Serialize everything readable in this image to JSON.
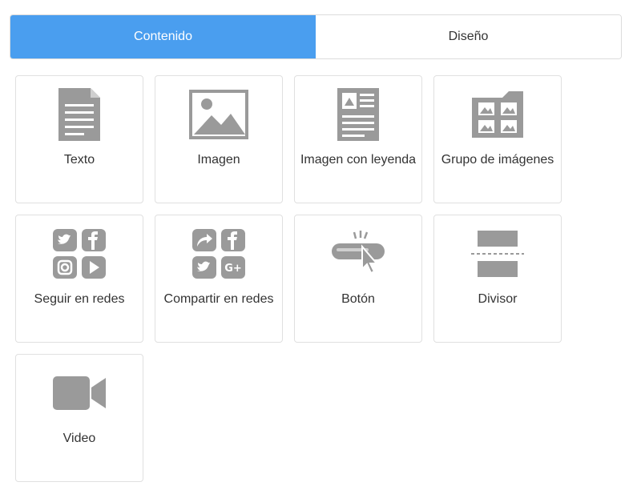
{
  "tabs": [
    {
      "label": "Contenido",
      "active": true
    },
    {
      "label": "Diseño",
      "active": false
    }
  ],
  "blocks": [
    {
      "label": "Texto",
      "icon": "text-document-icon"
    },
    {
      "label": "Imagen",
      "icon": "image-icon"
    },
    {
      "label": "Imagen con leyenda",
      "icon": "image-caption-icon"
    },
    {
      "label": "Grupo de imágenes",
      "icon": "image-group-icon"
    },
    {
      "label": "Seguir en redes",
      "icon": "social-follow-icon"
    },
    {
      "label": "Compartir en redes",
      "icon": "social-share-icon"
    },
    {
      "label": "Botón",
      "icon": "button-click-icon"
    },
    {
      "label": "Divisor",
      "icon": "divider-icon"
    },
    {
      "label": "Video",
      "icon": "video-camera-icon"
    }
  ],
  "colors": {
    "accent": "#4a9eef",
    "icon": "#9a9a9a",
    "border": "#e0e0e0"
  }
}
